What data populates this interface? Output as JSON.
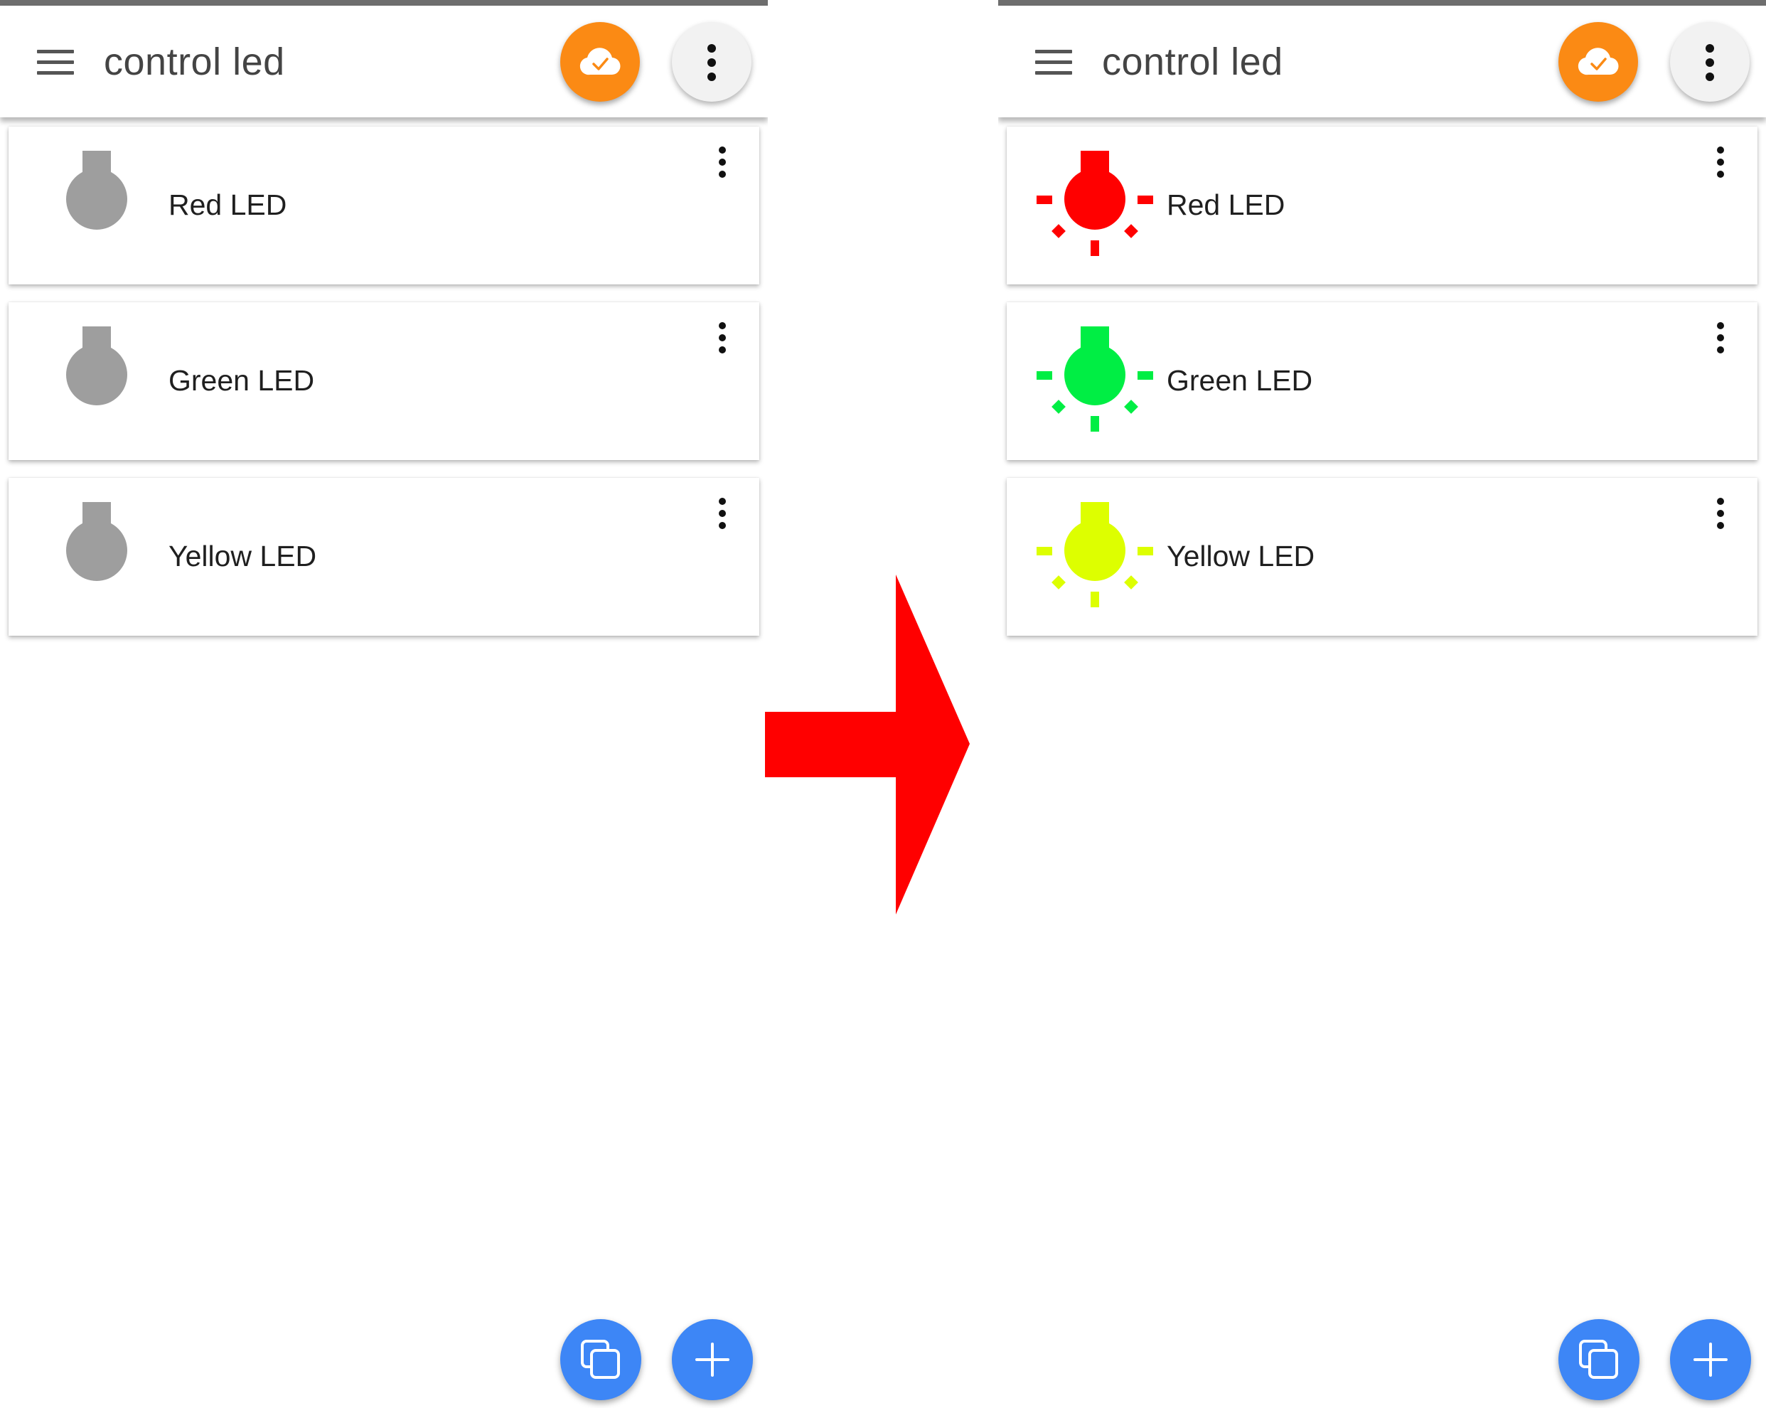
{
  "app": {
    "title": "control led"
  },
  "colors": {
    "off": "#9e9e9e",
    "red": "#ff0000",
    "green": "#00ee44",
    "yellow": "#ddff00",
    "cloud_button": "#fb8a14",
    "fab": "#3d86f6",
    "arrow": "#ff0000"
  },
  "icons": {
    "menu": "hamburger-menu-icon",
    "cloud": "cloud-check-icon",
    "overflow": "more-vert-icon",
    "bulb_off": "bulb-off-icon",
    "bulb_on": "bulb-on-icon",
    "copy": "copy-icon",
    "add": "add-icon",
    "transition": "right-arrow"
  },
  "screens": [
    {
      "state": "off",
      "leds": [
        {
          "label": "Red LED",
          "on": false,
          "color": "#9e9e9e"
        },
        {
          "label": "Green LED",
          "on": false,
          "color": "#9e9e9e"
        },
        {
          "label": "Yellow LED",
          "on": false,
          "color": "#9e9e9e"
        }
      ]
    },
    {
      "state": "on",
      "leds": [
        {
          "label": "Red LED",
          "on": true,
          "color": "#ff0000"
        },
        {
          "label": "Green LED",
          "on": true,
          "color": "#00ee44"
        },
        {
          "label": "Yellow LED",
          "on": true,
          "color": "#ddff00"
        }
      ]
    }
  ]
}
